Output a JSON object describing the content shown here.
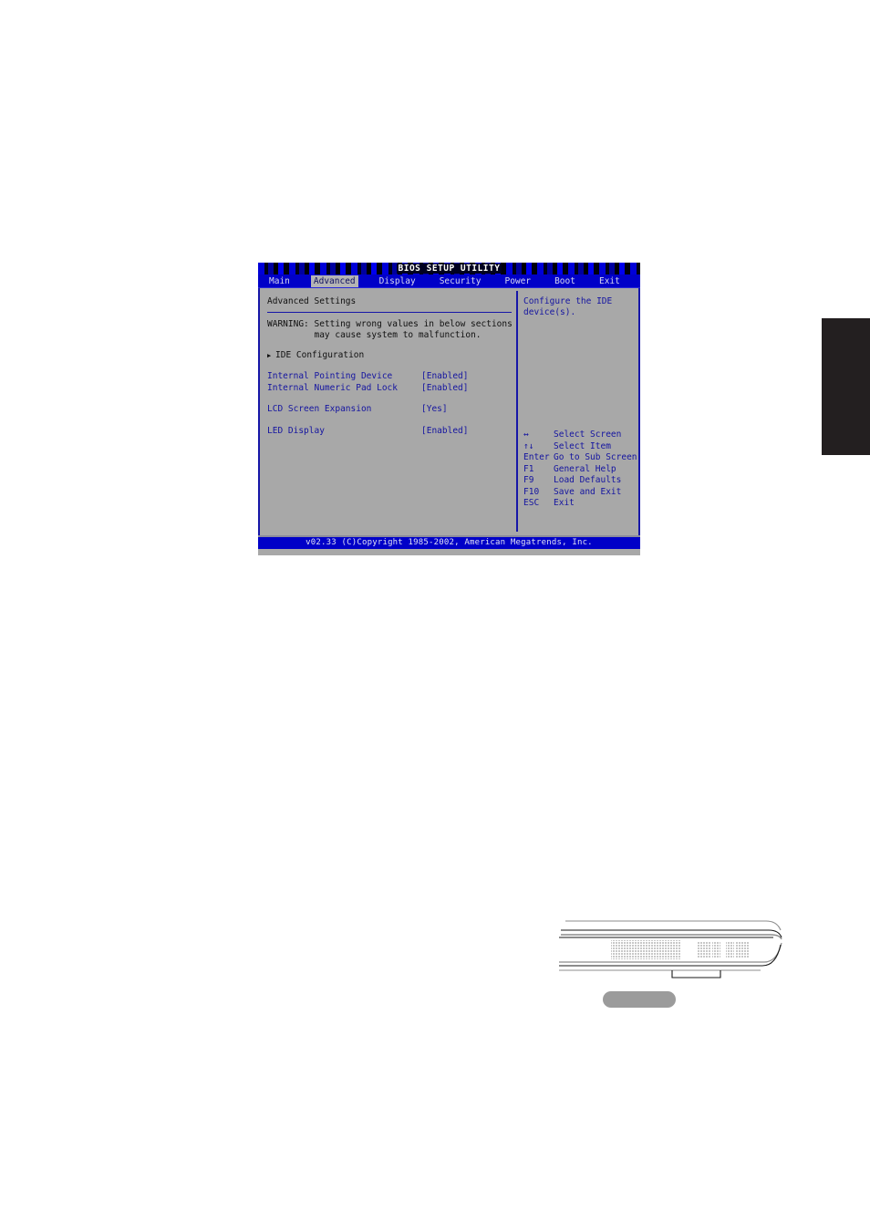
{
  "bios": {
    "title": "BIOS SETUP UTILITY",
    "menu": [
      {
        "label": "Main",
        "active": false
      },
      {
        "label": "Advanced",
        "active": true
      },
      {
        "label": "Display",
        "active": false
      },
      {
        "label": "Security",
        "active": false
      },
      {
        "label": "Power",
        "active": false
      },
      {
        "label": "Boot",
        "active": false
      },
      {
        "label": "Exit",
        "active": false
      }
    ],
    "panel_heading": "Advanced Settings",
    "warning_line1": "WARNING: Setting wrong values in below sections",
    "warning_line2": "         may cause system to malfunction.",
    "submenu": {
      "icon": "right-triangle-icon",
      "label": "IDE Configuration",
      "arrow_glyph": "▶"
    },
    "options": [
      {
        "label": "Internal Pointing Device",
        "value": "[Enabled]"
      },
      {
        "label": "Internal Numeric Pad Lock",
        "value": "[Enabled]"
      },
      {
        "label": "LCD Screen Expansion",
        "value": "[Yes]"
      },
      {
        "label": "LED Display",
        "value": "[Enabled]"
      }
    ],
    "help_text": "Configure the IDE\ndevice(s).",
    "key_legend": [
      {
        "key": "↔",
        "desc": "Select Screen"
      },
      {
        "key": "↑↓",
        "desc": "Select Item"
      },
      {
        "key": "Enter",
        "desc": "Go to Sub Screen"
      },
      {
        "key": "F1",
        "desc": "General Help"
      },
      {
        "key": "F9",
        "desc": "Load Defaults"
      },
      {
        "key": "F10",
        "desc": "Save and Exit"
      },
      {
        "key": "ESC",
        "desc": "Exit"
      }
    ],
    "footer": "v02.33 (C)Copyright 1985-2002, American Megatrends, Inc.",
    "colors": {
      "background": "#a8a8a8",
      "menubar": "#0000c8",
      "text_blue": "#1414a0",
      "text_dark": "#101010",
      "highlight": "#b4b4b4",
      "border": "#1616a8",
      "title_text": "#ffffff"
    }
  },
  "illustration": {
    "name": "notebook-side-view",
    "vent_left": "vent-grille-left",
    "vent_right": "vent-grille-right",
    "pad": "rounded-pad-shape"
  },
  "thumb_tab": {
    "name": "chapter-thumb-index",
    "color": "#231f20"
  }
}
